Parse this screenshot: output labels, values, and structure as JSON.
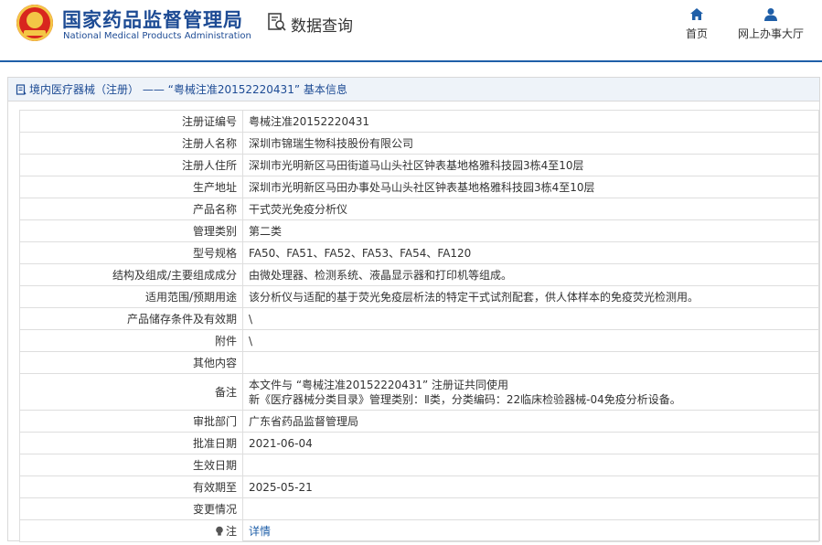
{
  "header": {
    "brand_cn": "国家药品监督管理局",
    "brand_en": "National Medical Products Administration",
    "query_label": "数据查询",
    "nav": [
      {
        "label": "首页",
        "icon": "home-icon"
      },
      {
        "label": "网上办事大厅",
        "icon": "user-icon"
      }
    ]
  },
  "panel": {
    "title": "境内医疗器械（注册） —— “粤械注准20152220431” 基本信息"
  },
  "details": [
    {
      "key": "注册证编号",
      "value": "粤械注准20152220431"
    },
    {
      "key": "注册人名称",
      "value": "深圳市锦瑞生物科技股份有限公司"
    },
    {
      "key": "注册人住所",
      "value": "深圳市光明新区马田街道马山头社区钟表基地格雅科技园3栋4至10层"
    },
    {
      "key": "生产地址",
      "value": "深圳市光明新区马田办事处马山头社区钟表基地格雅科技园3栋4至10层"
    },
    {
      "key": "产品名称",
      "value": "干式荧光免疫分析仪"
    },
    {
      "key": "管理类别",
      "value": "第二类"
    },
    {
      "key": "型号规格",
      "value": "FA50、FA51、FA52、FA53、FA54、FA120"
    },
    {
      "key": "结构及组成/主要组成成分",
      "value": "由微处理器、检测系统、液晶显示器和打印机等组成。"
    },
    {
      "key": "适用范围/预期用途",
      "value": "该分析仪与适配的基于荧光免疫层析法的特定干式试剂配套，供人体样本的免疫荧光检测用。"
    },
    {
      "key": "产品储存条件及有效期",
      "value": "\\"
    },
    {
      "key": "附件",
      "value": "\\"
    },
    {
      "key": "其他内容",
      "value": ""
    }
  ],
  "remark": {
    "key": "备注",
    "line1": "本文件与 “粤械注准20152220431” 注册证共同使用",
    "line2": "新《医疗器械分类目录》管理类别：Ⅱ类，分类编码：22临床检验器械-04免疫分析设备。"
  },
  "details_after": [
    {
      "key": "审批部门",
      "value": "广东省药品监督管理局"
    },
    {
      "key": "批准日期",
      "value": "2021-06-04"
    },
    {
      "key": "生效日期",
      "value": ""
    },
    {
      "key": "有效期至",
      "value": "2025-05-21"
    },
    {
      "key": "变更情况",
      "value": ""
    }
  ],
  "note": {
    "key": "注",
    "link": "详情"
  }
}
